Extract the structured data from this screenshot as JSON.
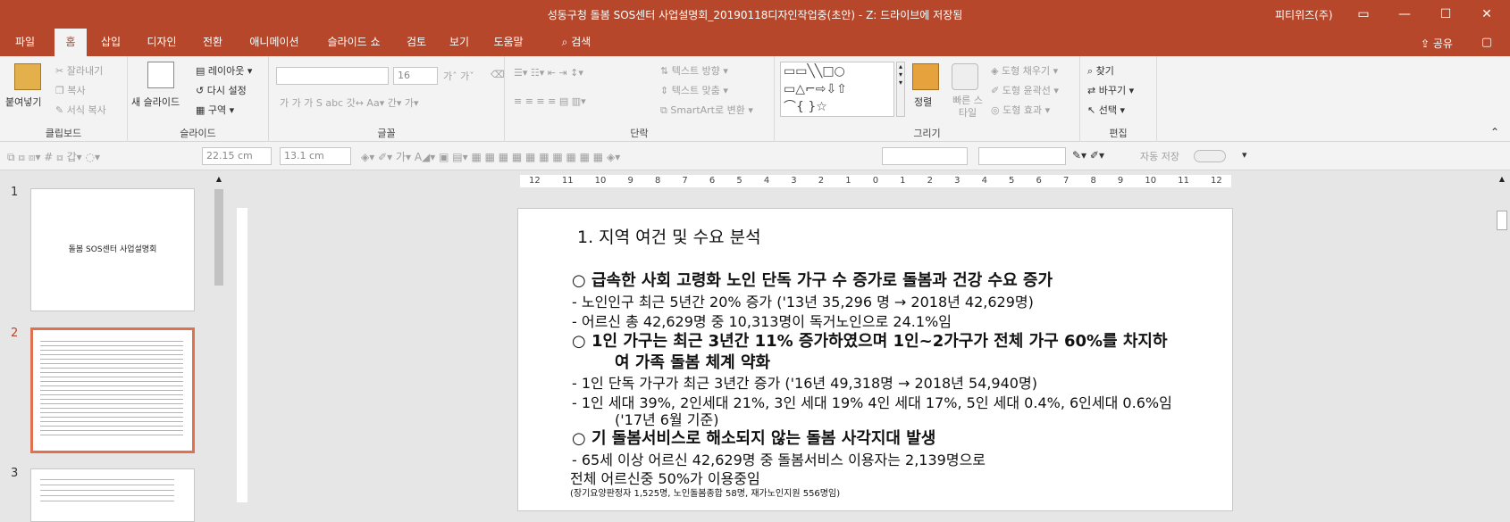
{
  "window": {
    "title": "성동구청 돌봄 SOS센터 사업설명회_20190118디자인작업중(초안) - Z: 드라이브에 저장됨",
    "user": "피티위즈(주)"
  },
  "tabs": [
    "파일",
    "홈",
    "삽입",
    "디자인",
    "전환",
    "애니메이션",
    "슬라이드 쇼",
    "검토",
    "보기",
    "도움말",
    "검색"
  ],
  "share_label": "공유",
  "ribbon": {
    "clipboard": {
      "paste": "붙여넣기",
      "cut": "잘라내기",
      "copy": "복사",
      "format_painter": "서식 복사",
      "label": "클립보드"
    },
    "slides": {
      "new_slide": "새 슬라이드",
      "layout": "레이아웃",
      "reset": "다시 설정",
      "section": "구역",
      "label": "슬라이드"
    },
    "font": {
      "font_name": "",
      "font_size": "16",
      "label": "글꼴"
    },
    "paragraph": {
      "text_direction": "텍스트 방향",
      "align_text": "텍스트 맞춤",
      "smartart": "SmartArt로 변환",
      "label": "단락"
    },
    "drawing": {
      "arrange": "정렬",
      "quick_styles": "빠른 스타일",
      "shape_fill": "도형 채우기",
      "shape_outline": "도형 윤곽선",
      "shape_effects": "도형 효과",
      "label": "그리기"
    },
    "editing": {
      "find": "찾기",
      "replace": "바꾸기",
      "select": "선택",
      "label": "편집"
    }
  },
  "quickbar": {
    "width": "22.15 cm",
    "height": "13.1 cm",
    "autosave": "자동 저장"
  },
  "ruler_ticks": [
    "12",
    "11",
    "10",
    "9",
    "8",
    "7",
    "6",
    "5",
    "4",
    "3",
    "2",
    "1",
    "0",
    "1",
    "2",
    "3",
    "4",
    "5",
    "6",
    "7",
    "8",
    "9",
    "10",
    "11",
    "12"
  ],
  "slides": [
    {
      "number": "1",
      "title": "돌봄 SOS센터 사업설명회"
    },
    {
      "number": "2",
      "title": ""
    },
    {
      "number": "3",
      "title": ""
    }
  ],
  "slide_content": {
    "title": "1. 지역 여건 및 수요 분석",
    "heading1": "○ 급속한 사회 고령화 노인 단독 가구 수 증가로 돌봄과 건강 수요 증가",
    "bullet1a": "- 노인인구 최근 5년간 20% 증가 ('13년 35,296 명 → 2018년 42,629명)",
    "bullet1b": "- 어르신 총 42,629명 중 10,313명이 독거노인으로 24.1%임",
    "heading2a": "○ 1인 가구는 최근 3년간 11% 증가하였으며 1인~2가구가 전체 가구 60%를 차지하",
    "heading2b": "여 가족 돌봄 체계 약화",
    "bullet2a": "- 1인 단독 가구가 최근 3년간 증가 ('16년 49,318명 → 2018년 54,940명)",
    "bullet2b": "- 1인 세대 39%, 2인세대 21%, 3인 세대 19% 4인 세대 17%, 5인 세대 0.4%, 6인세대 0.6%임",
    "bullet2c": "('17년 6월 기준)",
    "heading3": "○ 기 돌봄서비스로 해소되지 않는 돌봄 사각지대 발생",
    "bullet3a": "- 65세 이상 어르신 42,629명 중 돌봄서비스 이용자는 2,139명으로",
    "bullet3b": "전체 어르신중 50%가 이용중임",
    "bullet3c": "(장기요양판정자 1,525명, 노인돌봄종합 58명, 재가노인지원 556명임)"
  }
}
